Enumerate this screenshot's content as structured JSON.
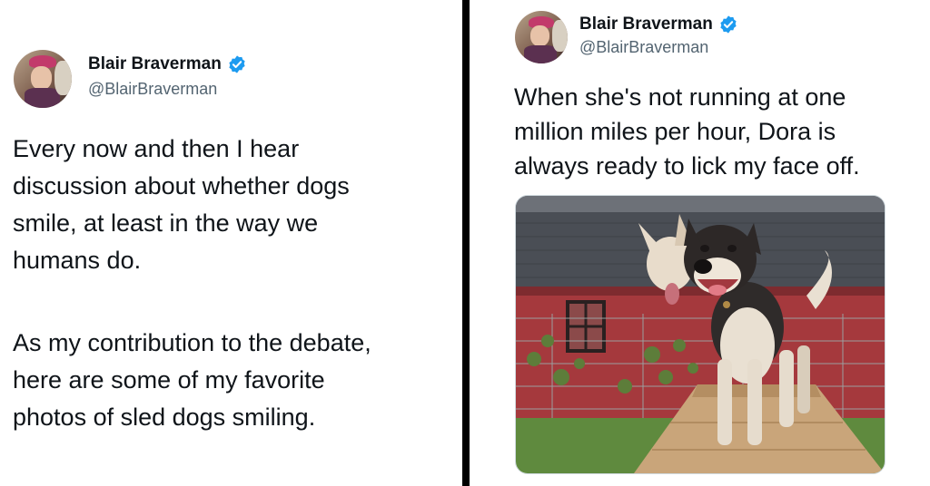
{
  "left_tweet": {
    "display_name": "Blair Braverman",
    "handle": "@BlairBraverman",
    "paragraph_1": "Every now and then I hear\ndiscussion about whether dogs\nsmile, at least in the way we\nhumans do.",
    "paragraph_2": "As my contribution to the debate,\nhere are some of my favorite\nphotos of sled dogs smiling."
  },
  "right_tweet": {
    "display_name": "Blair Braverman",
    "handle": "@BlairBraverman",
    "text": "When she's not running at one\nmillion miles per hour, Dora is\nalways ready to lick my face off."
  },
  "icons": {
    "verified": "verified-badge-icon",
    "avatar": "avatar"
  },
  "colors": {
    "verified_blue": "#1d9bf0",
    "text_primary": "#0f1419",
    "text_secondary": "#536471",
    "divider": "#000000"
  }
}
